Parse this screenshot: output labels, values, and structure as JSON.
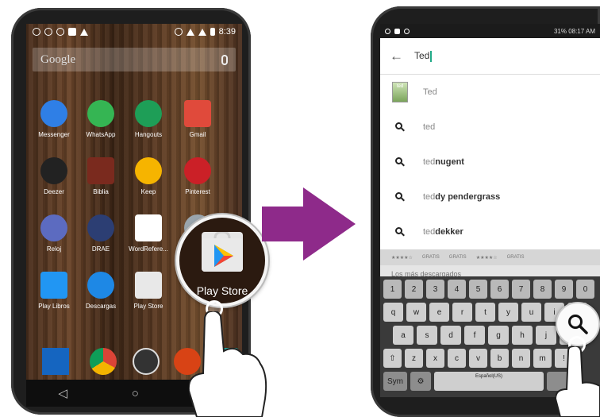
{
  "left_phone": {
    "status_time": "8:39",
    "search_placeholder": "Google",
    "apps": [
      {
        "label": "Messenger",
        "icon": "messenger-icon",
        "color": "#2f7fe6"
      },
      {
        "label": "WhatsApp",
        "icon": "whatsapp-icon",
        "color": "#35b553"
      },
      {
        "label": "Hangouts",
        "icon": "hangouts-icon",
        "color": "#1e9e57"
      },
      {
        "label": "Gmail",
        "icon": "gmail-icon",
        "color": "#e04a3b"
      },
      {
        "label": "Deezer",
        "icon": "deezer-icon",
        "color": "#222222"
      },
      {
        "label": "Biblia",
        "icon": "bible-icon",
        "color": "#7a2a1e"
      },
      {
        "label": "Keep",
        "icon": "keep-icon",
        "color": "#f6b400"
      },
      {
        "label": "Pinterest",
        "icon": "pinterest-icon",
        "color": "#cb2027"
      },
      {
        "label": "Reloj",
        "icon": "clock-icon",
        "color": "#5c6bc0"
      },
      {
        "label": "DRAE",
        "icon": "drae-icon",
        "color": "#2c3e73"
      },
      {
        "label": "WordRefere...",
        "icon": "wordreference-icon",
        "color": "#ffffff"
      },
      {
        "label": "",
        "icon": "gray-app-icon",
        "color": "#9aa5ad"
      },
      {
        "label": "Play Libros",
        "icon": "play-books-icon",
        "color": "#2196f3"
      },
      {
        "label": "Descargas",
        "icon": "downloads-icon",
        "color": "#1e88e5"
      },
      {
        "label": "Play Store",
        "icon": "play-store-icon",
        "color": "#e8e8e8"
      }
    ],
    "magnified_label": "Play Store",
    "nav_back": "◁",
    "nav_home": "○",
    "nav_recents": "□"
  },
  "right_phone": {
    "status_text": "31% 08:17 AM",
    "query": "Ted",
    "suggestions": [
      {
        "prefix": "Ted",
        "rest": "",
        "icon": "ted-thumbnail"
      },
      {
        "prefix": "ted",
        "rest": "",
        "icon": "search-icon"
      },
      {
        "prefix": "ted",
        "rest": " nugent",
        "icon": "search-icon"
      },
      {
        "prefix": "ted",
        "rest": "dy pendergrass",
        "icon": "search-icon"
      },
      {
        "prefix": "ted",
        "rest": " dekker",
        "icon": "search-icon"
      }
    ],
    "thumb_text": "ted",
    "strip_labels": [
      "GRATIS",
      "GRATIS",
      "GRATIS"
    ],
    "strip_stars": "★★★★☆",
    "under_text": "Los más descargados",
    "keyboard": {
      "numbers": [
        "1",
        "2",
        "3",
        "4",
        "5",
        "6",
        "7",
        "8",
        "9",
        "0"
      ],
      "row1": [
        "q",
        "w",
        "e",
        "r",
        "t",
        "y",
        "u",
        "i",
        "o"
      ],
      "row2": [
        "a",
        "s",
        "d",
        "f",
        "g",
        "h",
        "j",
        "k"
      ],
      "row3": [
        "⇧",
        "z",
        "x",
        "c",
        "v",
        "b",
        "n",
        "m",
        "!"
      ],
      "sym": "Sym",
      "settings": "⚙",
      "space": "Español(US)"
    }
  },
  "colors": {
    "arrow": "#8e2a8a",
    "wood": "#5d3c24"
  }
}
